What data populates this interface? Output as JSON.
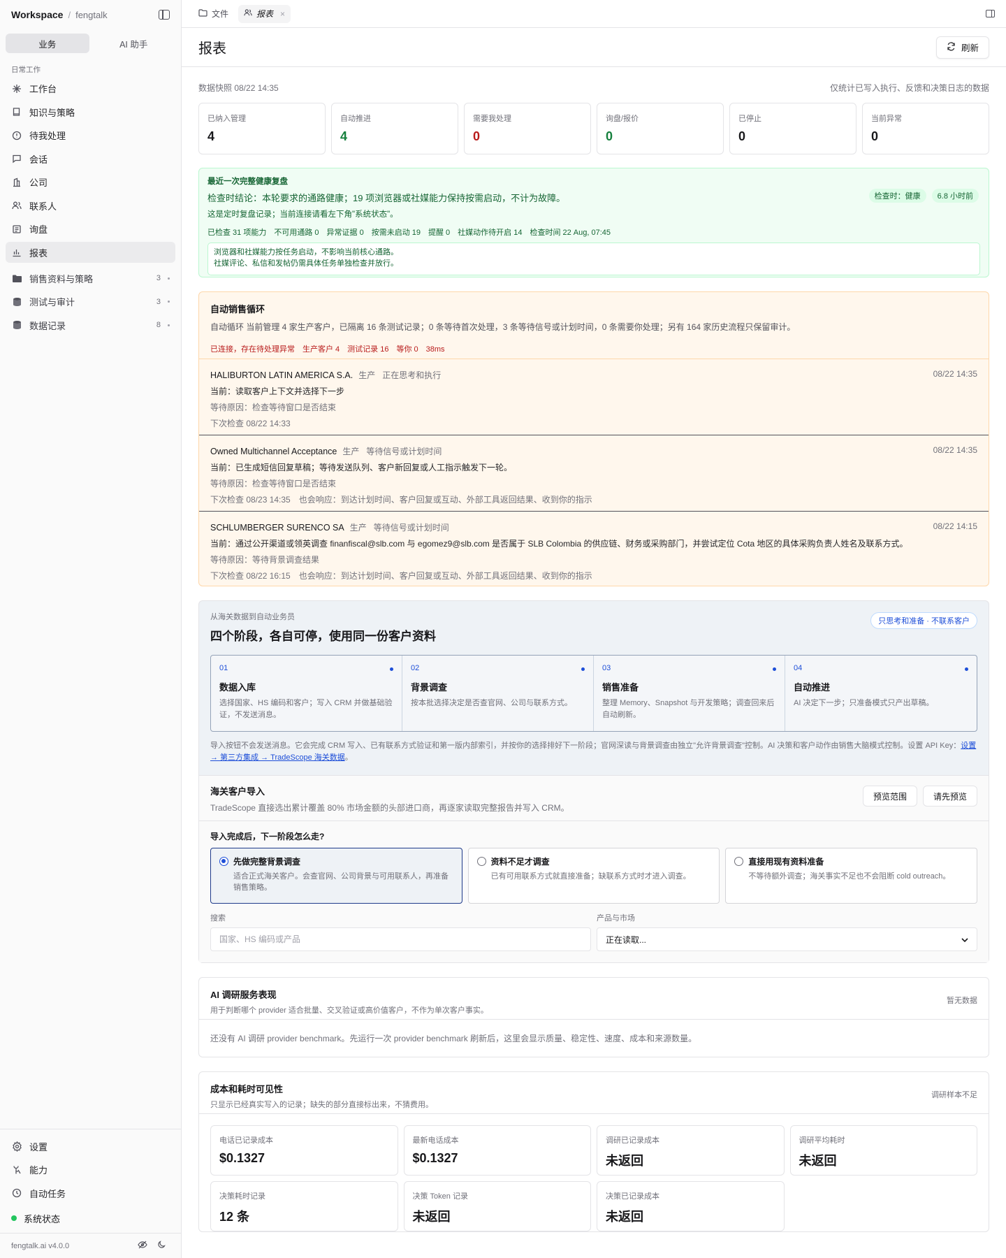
{
  "sidebar": {
    "workspace": "Workspace",
    "project": "fengtalk",
    "segments": [
      "业务",
      "AI 助手"
    ],
    "group_label": "日常工作",
    "nav": [
      {
        "label": "工作台",
        "icon": "sparkle-icon"
      },
      {
        "label": "知识与策略",
        "icon": "book-icon"
      },
      {
        "label": "待我处理",
        "icon": "alert-circle-icon"
      },
      {
        "label": "会话",
        "icon": "message-icon"
      },
      {
        "label": "公司",
        "icon": "building-icon"
      },
      {
        "label": "联系人",
        "icon": "users-icon"
      },
      {
        "label": "询盘",
        "icon": "inquiry-icon"
      },
      {
        "label": "报表",
        "icon": "chart-icon"
      }
    ],
    "folders": [
      {
        "label": "销售资料与策略",
        "count": "3",
        "icon": "folder-icon"
      },
      {
        "label": "测试与审计",
        "count": "3",
        "icon": "database-icon"
      },
      {
        "label": "数据记录",
        "count": "8",
        "icon": "database-icon"
      }
    ],
    "bottom": [
      {
        "label": "设置",
        "icon": "settings-icon"
      },
      {
        "label": "能力",
        "icon": "capability-icon"
      },
      {
        "label": "自动任务",
        "icon": "clock-icon"
      }
    ],
    "status": "系统状态",
    "version": "fengtalk.ai v4.0.0"
  },
  "tabs": [
    {
      "label": "文件",
      "icon": "folder-icon"
    },
    {
      "label": "报表",
      "icon": "users-icon",
      "close": "×"
    }
  ],
  "page": {
    "title": "报表",
    "refresh": "刷新"
  },
  "snapshot": {
    "left": "数据快照 08/22 14:35",
    "right": "仅统计已写入执行、反馈和决策日志的数据"
  },
  "kpis": [
    {
      "label": "已纳入管理",
      "value": "4",
      "tone": "default"
    },
    {
      "label": "自动推进",
      "value": "4",
      "tone": "green"
    },
    {
      "label": "需要我处理",
      "value": "0",
      "tone": "red"
    },
    {
      "label": "询盘/报价",
      "value": "0",
      "tone": "green"
    },
    {
      "label": "已停止",
      "value": "0",
      "tone": "default"
    },
    {
      "label": "当前异常",
      "value": "0",
      "tone": "default"
    }
  ],
  "health": {
    "title": "最近一次完整健康复盘",
    "conclusion": "检查时结论：本轮要求的通路健康；19 项浏览器或社媒能力保持按需启动，不计为故障。",
    "sub": "这是定时复盘记录；当前连接请看左下角\"系统状态\"。",
    "stats": "已检查 31 项能力　不可用通路 0　异常证据 0　按需未启动 19　提醒 0　社媒动作待开启 14　检查时间 22 Aug, 07:45",
    "chips": [
      "检查时：健康",
      "6.8 小时前"
    ],
    "box": [
      "浏览器和社媒能力按任务启动，不影响当前核心通路。",
      "社媒评论、私信和发帖仍需具体任务单独检查并放行。"
    ]
  },
  "loop": {
    "title": "自动销售循环",
    "desc": "自动循环 当前管理 4 家生产客户，已隔离 16 条测试记录；0 条等待首次处理，3 条等待信号或计划时间，0 条需要你处理；另有 164 家历史流程只保留审计。",
    "stat": "已连接，存在待处理异常　生产客户 4　测试记录 16　等你 0　38ms",
    "items": [
      {
        "name": "HALIBURTON LATIN AMERICA S.A.",
        "mode": "生产",
        "status": "正在思考和执行",
        "time": "08/22 14:35",
        "current": "当前：读取客户上下文并选择下一步",
        "wait": "等待原因：检查等待窗口是否结束",
        "next": "下次检查 08/22 14:33"
      },
      {
        "name": "Owned Multichannel Acceptance",
        "mode": "生产",
        "status": "等待信号或计划时间",
        "time": "08/22 14:35",
        "current": "当前：已生成短信回复草稿；等待发送队列、客户新回复或人工指示触发下一轮。",
        "wait": "等待原因：检查等待窗口是否结束",
        "next": "下次检查 08/23 14:35　也会响应：到达计划时间、客户回复或互动、外部工具返回结果、收到你的指示"
      },
      {
        "name": "SCHLUMBERGER SURENCO SA",
        "mode": "生产",
        "status": "等待信号或计划时间",
        "time": "08/22 14:15",
        "current": "当前：通过公开渠道或领英调查 finanfiscal@slb.com 与 egomez9@slb.com 是否属于 SLB Colombia 的供应链、财务或采购部门，并尝试定位 Cota 地区的具体采购负责人姓名及联系方式。",
        "wait": "等待原因：等待背景调查结果",
        "next": "下次检查 08/22 16:15　也会响应：到达计划时间、客户回复或互动、外部工具返回结果、收到你的指示"
      }
    ]
  },
  "stages": {
    "kicker": "从海关数据到自动业务员",
    "title": "四个阶段，各自可停，使用同一份客户资料",
    "pill": "只思考和准备 · 不联系客户",
    "steps": [
      {
        "num": "01",
        "name": "数据入库",
        "desc": "选择国家、HS 编码和客户；写入 CRM 并做基础验证，不发送消息。"
      },
      {
        "num": "02",
        "name": "背景调查",
        "desc": "按本批选择决定是否查官网、公司与联系方式。"
      },
      {
        "num": "03",
        "name": "销售准备",
        "desc": "整理 Memory、Snapshot 与开发策略；调查回来后自动刷新。"
      },
      {
        "num": "04",
        "name": "自动推进",
        "desc": "AI 决定下一步；只准备模式只产出草稿。"
      }
    ],
    "note": "导入按钮不会发送消息。它会完成 CRM 写入、已有联系方式验证和第一版内部索引，并按你的选择排好下一阶段；官网深读与背景调查由独立\"允许背景调查\"控制。AI 决策和客户动作由销售大脑模式控制。设置 API Key：",
    "note_link": "设置 → 第三方集成 → TradeScope 海关数据",
    "note_end": "。"
  },
  "import": {
    "title": "海关客户导入",
    "desc": "TradeScope 直接选出累计覆盖 80% 市场金额的头部进口商，再逐家读取完整报告并写入 CRM。",
    "preview_range": "预览范围",
    "preview_first": "请先预览",
    "question": "导入完成后，下一阶段怎么走?",
    "options": [
      {
        "title": "先做完整背景调查",
        "desc": "适合正式海关客户。会查官网、公司背景与可用联系人，再准备销售策略。",
        "selected": true
      },
      {
        "title": "资料不足才调查",
        "desc": "已有可用联系方式就直接准备；缺联系方式时才进入调查。",
        "selected": false
      },
      {
        "title": "直接用现有资料准备",
        "desc": "不等待额外调查；海关事实不足也不会阻断 cold outreach。",
        "selected": false
      }
    ],
    "search_label": "搜索",
    "search_placeholder": "国家、HS 编码或产品",
    "market_label": "产品与市场",
    "market_value": "正在读取..."
  },
  "ai_research": {
    "title": "AI 调研服务表现",
    "desc": "用于判断哪个 provider 适合批量、交叉验证或高价值客户，不作为单次客户事实。",
    "right": "暂无数据",
    "body": "还没有 AI 调研 provider benchmark。先运行一次 provider benchmark 刷新后，这里会显示质量、稳定性、速度、成本和来源数量。"
  },
  "costs": {
    "title": "成本和耗时可见性",
    "desc": "只显示已经真实写入的记录；缺失的部分直接标出来，不猜费用。",
    "right": "调研样本不足",
    "items": [
      {
        "label": "电话已记录成本",
        "value": "$0.1327"
      },
      {
        "label": "最新电话成本",
        "value": "$0.1327"
      },
      {
        "label": "调研已记录成本",
        "value": "未返回"
      },
      {
        "label": "调研平均耗时",
        "value": "未返回"
      },
      {
        "label": "决策耗时记录",
        "value": "12 条"
      },
      {
        "label": "决策 Token 记录",
        "value": "未返回"
      },
      {
        "label": "决策已记录成本",
        "value": "未返回"
      }
    ]
  }
}
